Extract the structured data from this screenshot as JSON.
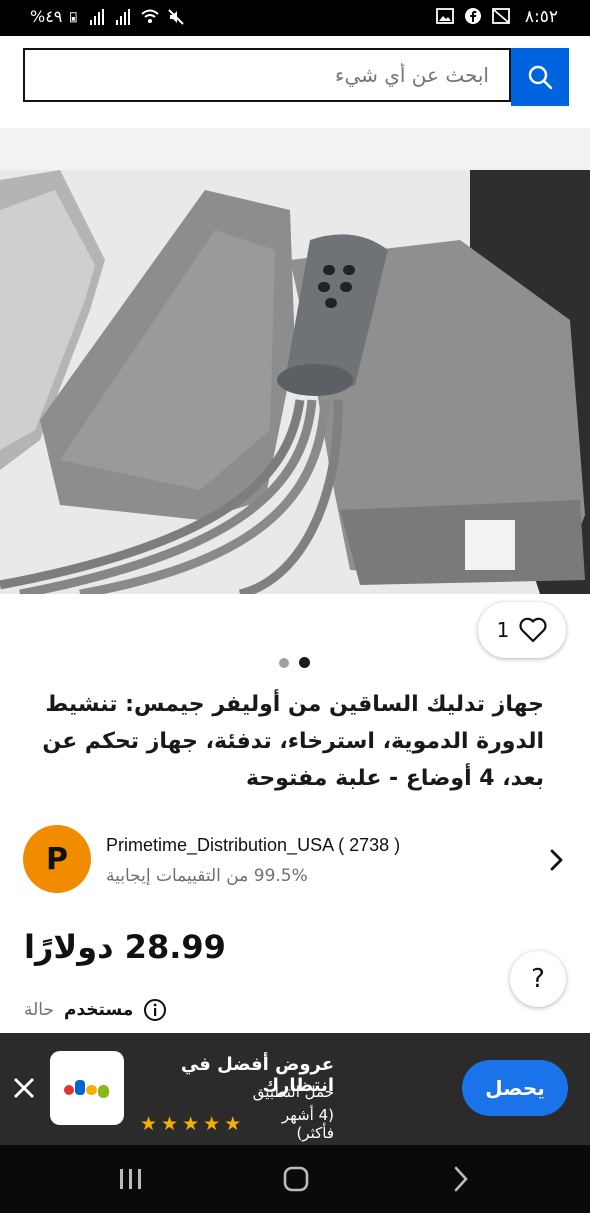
{
  "status_bar": {
    "time": "٨:٥٢",
    "battery_text": "%٤٩"
  },
  "search": {
    "placeholder": "ابحث عن أي شيء"
  },
  "product": {
    "watch_count": "1",
    "title": "جهاز تدليك الساقين من أوليفر جيمس: تنشيط الدورة الدموية، استرخاء، تدفئة، جهاز تحكم عن بعد، 4 أوضاع - علبة مفتوحة",
    "image_count": 2,
    "active_image": 2,
    "price": "28.99 دولارًا",
    "condition_label": "حالة",
    "condition_value": "مستخدم",
    "help_label": "?"
  },
  "seller": {
    "avatar_letter": "P",
    "name": "Primetime_Distribution_USA ( 2738 )",
    "feedback": "99.5% من التقييمات إيجابية"
  },
  "app_banner": {
    "title": "عروض أفضل في انتظارك",
    "subtitle": "حمل التطبيق",
    "rating_text": "(4 أشهر فأكثر)",
    "stars": 5,
    "get_label": "يحصل",
    "logo_letters": [
      "e",
      "b",
      "a",
      "y"
    ]
  },
  "colors": {
    "accent": "#0064e0",
    "avatar": "#f18c00",
    "star": "#f5af02",
    "get_button": "#1a73e8",
    "ebay_e": "#e53238",
    "ebay_b": "#0064d2",
    "ebay_a": "#f5af02",
    "ebay_y": "#86b817"
  }
}
